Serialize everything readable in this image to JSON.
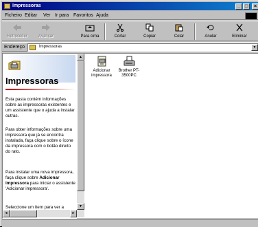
{
  "window": {
    "title": "Impressoras",
    "controls": [
      "_",
      "□",
      "×"
    ]
  },
  "menu": [
    "Ficheiro",
    "Editar",
    "Ver",
    "Ir para",
    "Favoritos",
    "Ajuda"
  ],
  "toolbar": {
    "back": "Retroceder",
    "forward": "Avançar",
    "up": "Para cima",
    "cut": "Cortar",
    "copy": "Copiar",
    "paste": "Colar",
    "undo": "Anular",
    "delete": "Eliminar"
  },
  "address": {
    "label": "Endereço",
    "value": "Impressoras"
  },
  "left_pane": {
    "title": "Impressoras",
    "para1": "Esta pasta contém informações sobre as impressoras existentes e um assistente que o ajuda a instalar outras.",
    "para2": "Para obter informações sobre uma impressora que já se encontra instalada, faça clique sobre o ícone da impressora com o botão direito do rato.",
    "para3_pre": "Para instalar uma nova impressora, faça clique sobre ",
    "para3_bold": "Adicionar impressora",
    "para3_post": " para iniciar o assistente 'Adicionar impressora'.",
    "para4": "Seleccione um item para ver a respectiva"
  },
  "items": [
    {
      "label": "Adicionar impressora"
    },
    {
      "label": "Brother PT-3500PC"
    }
  ]
}
